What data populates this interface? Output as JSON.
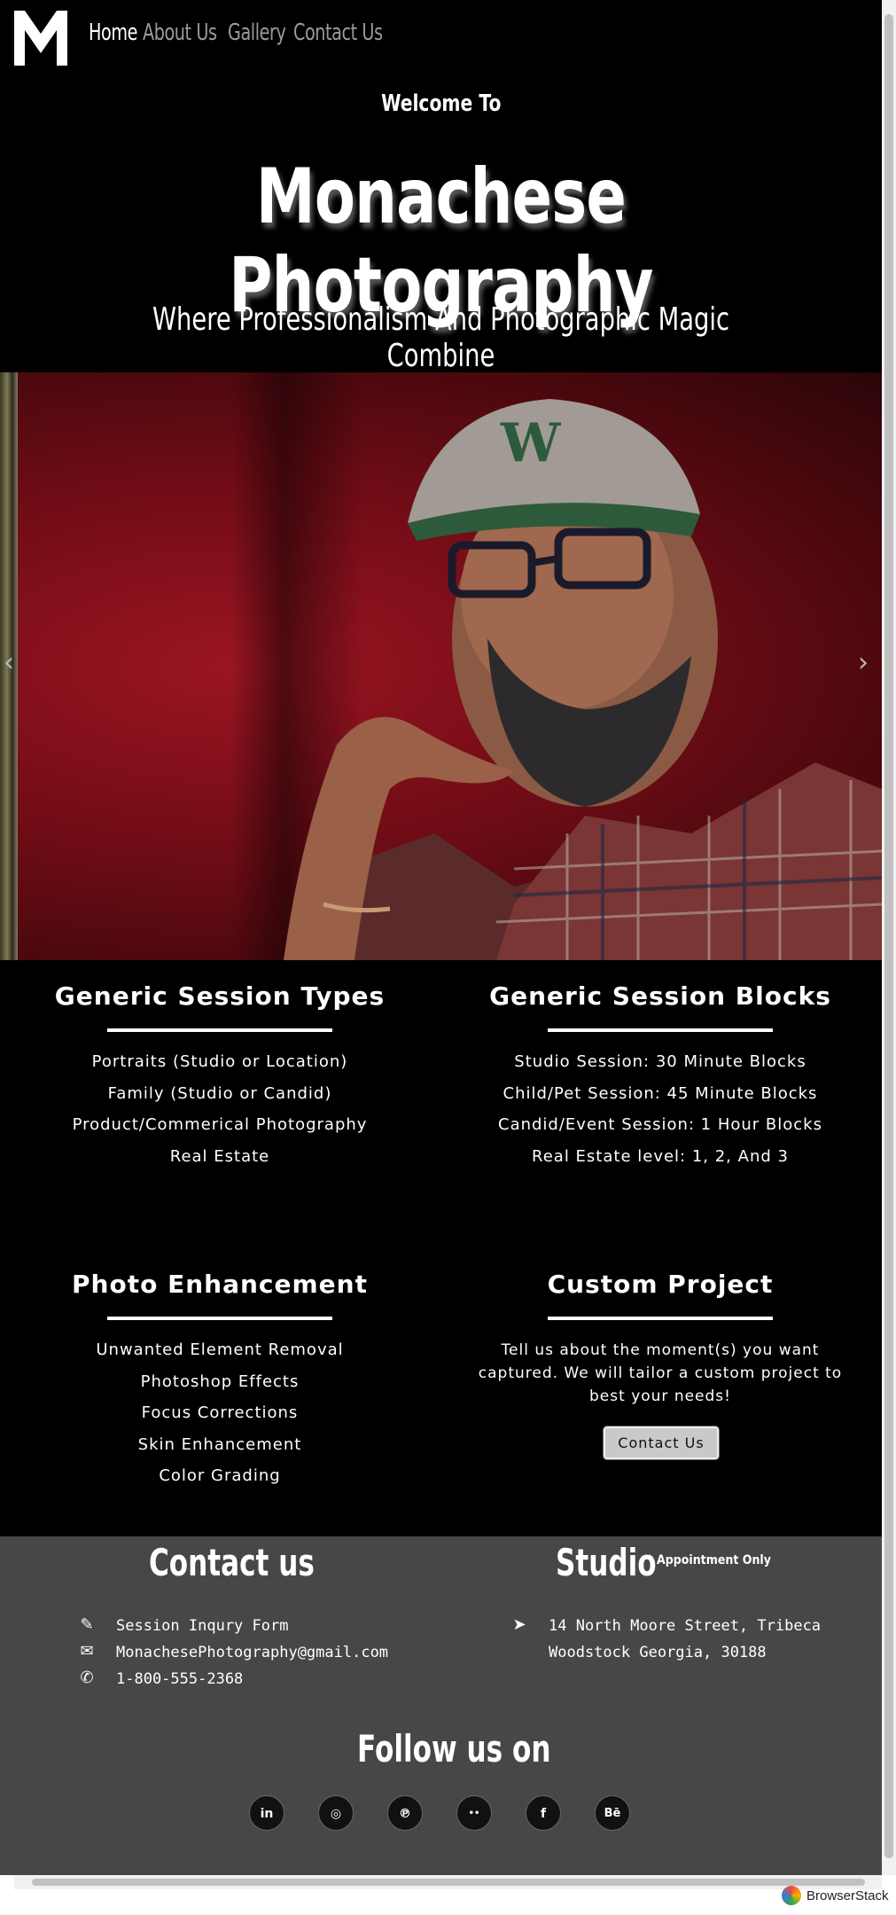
{
  "nav": {
    "logo_letter": "M",
    "links": [
      {
        "label": "Home",
        "active": true
      },
      {
        "label": "About Us",
        "active": false
      },
      {
        "label": "Gallery",
        "active": false
      },
      {
        "label": "Contact Us",
        "active": false
      }
    ]
  },
  "hero": {
    "welcome": "Welcome To",
    "title": "Monachese Photography",
    "tagline": "Where Professionalism And Photographic Magic Combine"
  },
  "carousel": {
    "prev_icon": "chevron-left-icon",
    "next_icon": "chevron-right-icon"
  },
  "services": {
    "session_types": {
      "title": "Generic Session Types",
      "items": [
        "Portraits (Studio or Location)",
        "Family (Studio or Candid)",
        "Product/Commerical Photography",
        "Real Estate"
      ]
    },
    "session_blocks": {
      "title": "Generic Session Blocks",
      "items": [
        "Studio Session: 30 Minute Blocks",
        "Child/Pet Session: 45 Minute Blocks",
        "Candid/Event Session: 1 Hour Blocks",
        "Real Estate level: 1, 2, And 3"
      ]
    },
    "photo_enhancement": {
      "title": "Photo Enhancement",
      "items": [
        "Unwanted Element Removal",
        "Photoshop Effects",
        "Focus Corrections",
        "Skin Enhancement",
        "Color Grading"
      ]
    },
    "custom_project": {
      "title": "Custom Project",
      "text": "Tell us about the moment(s) you want captured. We will tailor a custom project to best your needs!",
      "button": "Contact Us"
    }
  },
  "footer": {
    "contact_heading": "Contact us",
    "studio_heading": "Studio",
    "studio_note": "* Appointment Only",
    "contact_items": [
      {
        "icon": "edit-icon",
        "text": "Session Inqury Form"
      },
      {
        "icon": "envelope-icon",
        "text": "MonachesePhotography@gmail.com"
      },
      {
        "icon": "phone-icon",
        "text": "1-800-555-2368"
      }
    ],
    "address_icon": "location-arrow-icon",
    "address_line1": "14 North Moore Street, Tribeca",
    "address_line2": "Woodstock Georgia, 30188",
    "follow_heading": "Follow us on",
    "social": [
      {
        "icon": "linkedin-icon",
        "glyph": "in"
      },
      {
        "icon": "instagram-icon",
        "glyph": "◎"
      },
      {
        "icon": "pinterest-icon",
        "glyph": "℗"
      },
      {
        "icon": "flickr-icon",
        "glyph": "••"
      },
      {
        "icon": "facebook-icon",
        "glyph": "f"
      },
      {
        "icon": "behance-icon",
        "glyph": "Bē"
      }
    ]
  },
  "browser": {
    "badge": "BrowserStack"
  },
  "colors": {
    "background": "#000000",
    "footer": "#474747",
    "nav_inactive": "#9a9a9a",
    "slide_red": "#8b1420"
  }
}
